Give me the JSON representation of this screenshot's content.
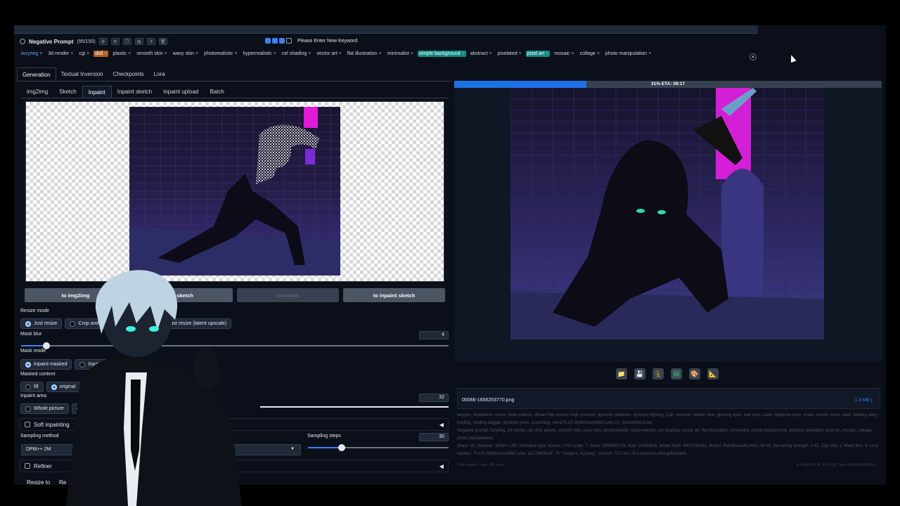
{
  "negative_prompt": {
    "title": "Negative Prompt",
    "count": "(95/150)",
    "keyword_placeholder": "Please Enter New Keyword",
    "tags": [
      {
        "text": "lazyneg",
        "style": "blue"
      },
      {
        "text": "3d render",
        "style": "plain"
      },
      {
        "text": "cgi",
        "style": "plain"
      },
      {
        "text": "doll",
        "style": "orange"
      },
      {
        "text": "plastic",
        "style": "plain"
      },
      {
        "text": "smooth skin",
        "style": "plain"
      },
      {
        "text": "waxy skin",
        "style": "plain"
      },
      {
        "text": "photorealistic",
        "style": "plain"
      },
      {
        "text": "hyperrealistic",
        "style": "plain"
      },
      {
        "text": "cel shading",
        "style": "plain"
      },
      {
        "text": "vector art",
        "style": "plain"
      },
      {
        "text": "flat illustration",
        "style": "plain"
      },
      {
        "text": "minimalist",
        "style": "plain"
      },
      {
        "text": "simple background",
        "style": "teal"
      },
      {
        "text": "abstract",
        "style": "plain"
      },
      {
        "text": "pixelated",
        "style": "plain"
      },
      {
        "text": "pixel art",
        "style": "teal"
      },
      {
        "text": "mosaic",
        "style": "plain"
      },
      {
        "text": "collage",
        "style": "plain"
      },
      {
        "text": "photo manipulation",
        "style": "plain"
      }
    ]
  },
  "main_tabs": [
    "Generation",
    "Textual Inversion",
    "Checkpoints",
    "Lora"
  ],
  "sub_tabs": [
    "img2img",
    "Sketch",
    "Inpaint",
    "Inpaint sketch",
    "Inpaint upload",
    "Batch"
  ],
  "send_buttons": [
    "to img2img",
    "to sketch",
    "to inpaint",
    "to inpaint sketch"
  ],
  "resize_mode": {
    "label": "Resize mode",
    "opt1": "Just resize",
    "opt2": "Crop and resi",
    "opt3": "Just resize (latent upscale)"
  },
  "mask_blur": {
    "label": "Mask blur",
    "value": "4",
    "fraction": 0.06
  },
  "mask_mode": {
    "label": "Mask mode",
    "opt1": "Inpaint masked",
    "opt2": "Inpaint not"
  },
  "masked_content": {
    "label": "Masked content",
    "opt1": "fill",
    "opt2": "original",
    "opt3": "la"
  },
  "inpaint_area": {
    "label": "Inpaint area",
    "opt1": "Whole picture"
  },
  "padding": {
    "value": "32"
  },
  "soft_inpainting": "Soft inpainting",
  "sampling_method": {
    "label": "Sampling method",
    "value": "DPM++ 2M"
  },
  "sampling_steps": {
    "label": "Sampling steps",
    "value": "30",
    "fraction": 0.24
  },
  "refiner": "Refiner",
  "resize_to": {
    "label": "Resize to",
    "tab": "Re"
  },
  "progress": {
    "text": "31% ETA: 09:17",
    "percent": 31
  },
  "output": {
    "filename": "00066-1656253770.png",
    "size": "1.3 MB ⤓",
    "positive": "lazypos, illustration, comic, bold outlines, vibrant flat colours, high contrast, dynamic shadows, dynamic lighting, 1girl, evasive, hidden face, glowing eyes, teal eyes, cape, magenta eyes, mask, demon mask, dark, fantasy, alley, holding, holding dagger, dynamic pose, crouching, <lora:FLUX.MythSmoothBtl.1vee:1>, SmoothBtl.1vee,",
    "negative": "Negative prompt: lazyneg, 3d render, cgi, doll, plastic, smooth skin, waxy skin, photorealistic, hyperrealistic, cel shading, vector art, flat illustration, minimalist, simple background, abstract, pixelated, pixel art, mosaic, collage, photo manipulation,",
    "params": "Steps: 30, Sampler: DPM++ 2M, Schedule type: Karras, CFG scale: 7, Seed: 3859969178, Size: 1008x808, Model hash: 5472030362, Model: PlantBasedComics-48-40, Denoising strength: 0.41, Clip skip: 2, Mask blur: 4, Lora hashes: \"FLUX.MythSmoothBtl.1vee: a1173408a4f\", TI: \"lazypos, lazyneg\", Version: f2.0.1v1.10.1-previous-669-gdfdcbab6",
    "time": "Time taken: 2 min. 38.4 sec.",
    "vram": "A: 4.89 GB, R: 5.09 GB, Sys: 8.89 GB (69.0%)"
  }
}
